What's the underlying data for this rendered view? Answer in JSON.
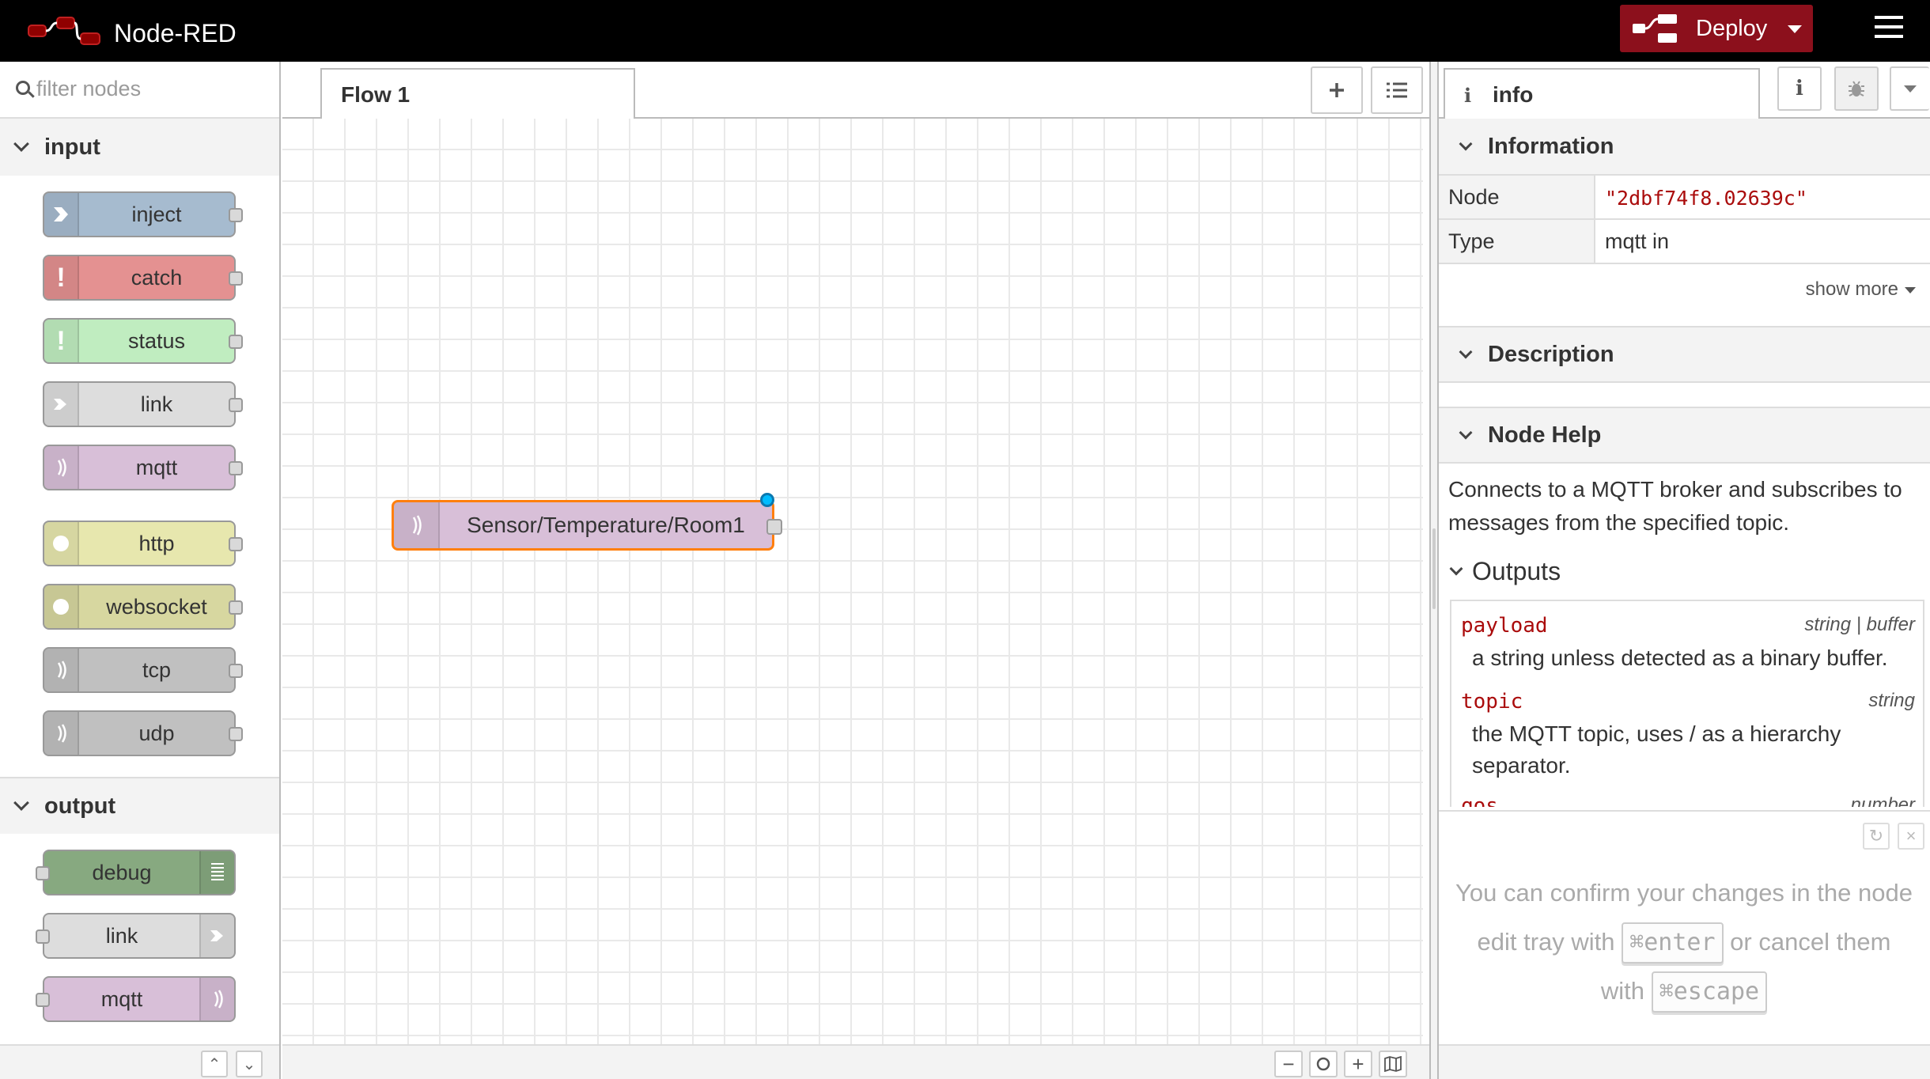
{
  "header": {
    "title": "Node-RED",
    "deploy_label": "Deploy"
  },
  "palette": {
    "search_placeholder": "filter nodes",
    "categories": [
      {
        "label": "input",
        "nodes": [
          {
            "label": "inject",
            "color": "#a6bbcf",
            "icon": "arrow-right-icon"
          },
          {
            "label": "catch",
            "color": "#e49191",
            "icon": "exclamation-icon"
          },
          {
            "label": "status",
            "color": "#c0edc0",
            "icon": "exclamation-icon"
          },
          {
            "label": "link",
            "color": "#dddddd",
            "icon": "link-in-icon"
          },
          {
            "label": "mqtt",
            "color": "#d8bfd8",
            "icon": "bridge-icon"
          },
          {
            "label": "http",
            "color": "#e7e7ae",
            "icon": "globe-icon"
          },
          {
            "label": "websocket",
            "color": "#d7d7a0",
            "icon": "globe-icon"
          },
          {
            "label": "tcp",
            "color": "#c0c0c0",
            "icon": "bridge-icon"
          },
          {
            "label": "udp",
            "color": "#c0c0c0",
            "icon": "bridge-icon"
          }
        ]
      },
      {
        "label": "output",
        "nodes": [
          {
            "label": "debug",
            "color": "#87a980",
            "icon": "debug-icon"
          },
          {
            "label": "link",
            "color": "#dddddd",
            "icon": "link-out-icon"
          },
          {
            "label": "mqtt",
            "color": "#d8bfd8",
            "icon": "bridge-icon"
          }
        ]
      }
    ]
  },
  "workspace": {
    "tab_label": "Flow 1",
    "node_label": "Sensor/Temperature/Room1",
    "node_color": "#d8bfd8",
    "selected_color": "#ff7f0e"
  },
  "sidebar": {
    "tab_label": "info",
    "information_title": "Information",
    "node_key": "Node",
    "node_value": "\"2dbf74f8.02639c\"",
    "type_key": "Type",
    "type_value": "mqtt in",
    "show_more": "show more",
    "description_title": "Description",
    "node_help_title": "Node Help",
    "help_text": "Connects to a MQTT broker and subscribes to messages from the specified topic.",
    "outputs_title": "Outputs",
    "outputs": [
      {
        "name": "payload",
        "type": "string | buffer",
        "desc": "a string unless detected as a binary buffer."
      },
      {
        "name": "topic",
        "type": "string",
        "desc": "the MQTT topic, uses / as a hierarchy separator."
      },
      {
        "name": "qos",
        "type": "number",
        "desc": ""
      }
    ],
    "tips": {
      "line1": "You can confirm your changes in the node edit tray with",
      "key1": "⌘enter",
      "or": "or",
      "line2": "cancel them with",
      "key2": "⌘escape"
    }
  },
  "colors": {
    "header_bg": "#000000",
    "deploy_bg": "#8c101c",
    "code_red": "#aa0b0b"
  }
}
